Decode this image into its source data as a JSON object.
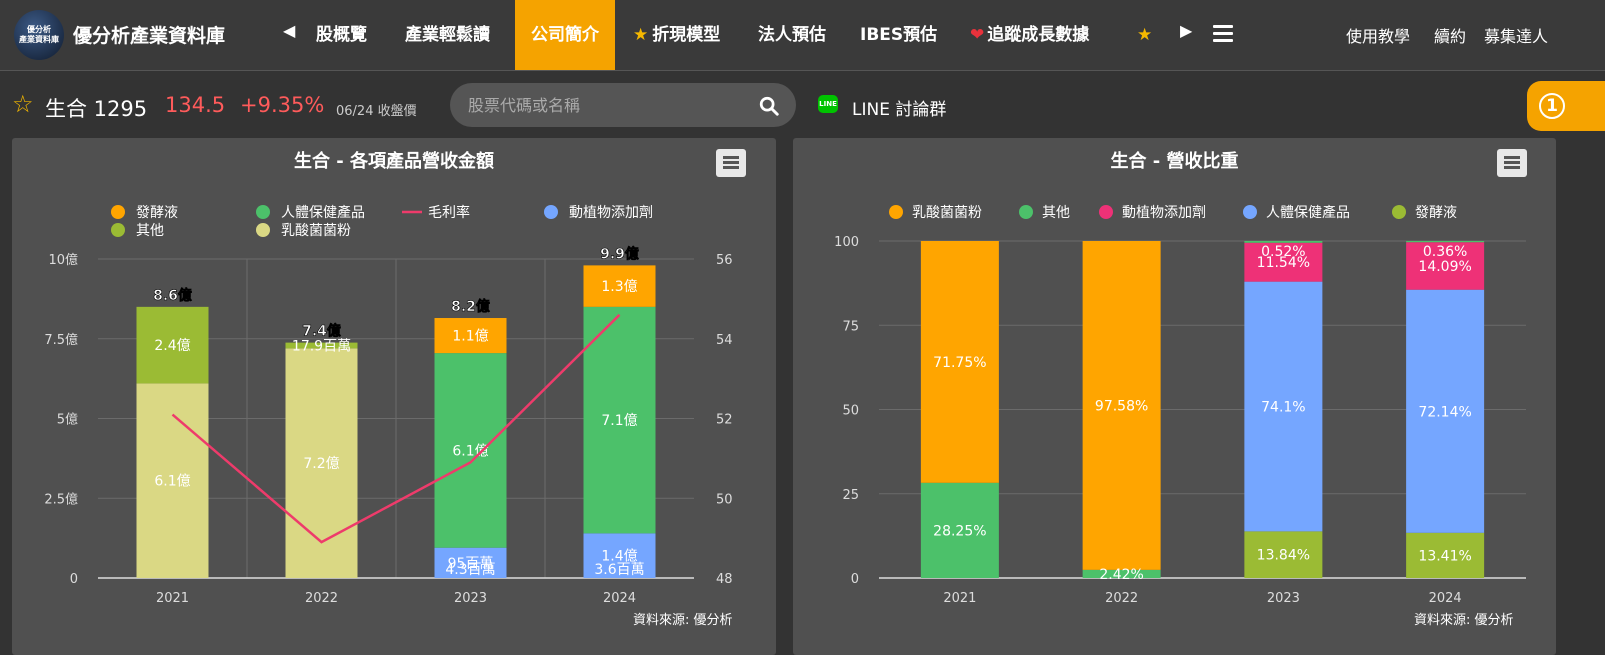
{
  "header": {
    "logo_text": [
      "優分析",
      "產業資料庫"
    ],
    "site_title": "優分析產業資料庫",
    "nav_items": [
      {
        "label": "股概覽",
        "icon": ""
      },
      {
        "label": "產業輕鬆讀",
        "icon": ""
      },
      {
        "label": "公司簡介",
        "icon": "",
        "active": true
      },
      {
        "label": "折現模型",
        "icon": "star-icon"
      },
      {
        "label": "法人預估",
        "icon": ""
      },
      {
        "label": "IBES預估",
        "icon": ""
      },
      {
        "label": "追蹤成長數據",
        "icon": "heart-icon"
      },
      {
        "label": "",
        "icon": "star-icon"
      }
    ],
    "right_links": [
      "使用教學",
      "續約",
      "募集達人"
    ]
  },
  "stock": {
    "name": "生合 1295",
    "price": "134.5",
    "change": "+9.35%",
    "date": "06/24 收盤價"
  },
  "search": {
    "placeholder": "股票代碼或名稱"
  },
  "line_group": {
    "label": "LINE 討論群"
  },
  "notification": {
    "count": "1"
  },
  "colors": {
    "orange": "#ffa500",
    "green": "#4cc16a",
    "lightgreen": "#9bbb34",
    "yellow": "#dad884",
    "blue": "#75a6ff",
    "pink": "#ee3177",
    "line": "#ee3b6b"
  },
  "chart_data": [
    {
      "type": "bar",
      "title": "生合 - 各項產品營收金額",
      "source": "資料來源: 優分析",
      "categories": [
        "2021",
        "2022",
        "2023",
        "2024"
      ],
      "y_ticks": [
        "0",
        "2.5億",
        "5億",
        "7.5億",
        "10億"
      ],
      "y2_ticks": [
        "48",
        "50",
        "52",
        "54",
        "56"
      ],
      "ylim": [
        0,
        10
      ],
      "y2lim": [
        48,
        56
      ],
      "legend": [
        "發酵液",
        "人體保健產品",
        "毛利率",
        "動植物添加劑",
        "其他",
        "乳酸菌菌粉"
      ],
      "series": [
        {
          "name": "乳酸菌菌粉",
          "color": "#dad884",
          "values": [
            6.1,
            7.2,
            0,
            0
          ],
          "labels": [
            "6.1億",
            "7.2億",
            "",
            ""
          ]
        },
        {
          "name": "其他",
          "color": "#9bbb34",
          "values": [
            2.4,
            0.179,
            0,
            0
          ],
          "labels": [
            "2.4億",
            "17.9百萬",
            "",
            ""
          ]
        },
        {
          "name": "動植物添加劑",
          "color": "#75a6ff",
          "values": [
            0,
            0,
            0.95,
            1.4
          ],
          "labels": [
            "",
            "",
            "95百萬",
            "1.4億"
          ]
        },
        {
          "name": "人體保健產品",
          "color": "#4cc16a",
          "values": [
            0,
            0,
            6.1,
            7.1
          ],
          "labels": [
            "",
            "",
            "6.1億",
            "7.1億"
          ]
        },
        {
          "name": "發酵液",
          "color": "#ffa500",
          "values": [
            0,
            0,
            1.1,
            1.3
          ],
          "labels": [
            "",
            "",
            "1.1億",
            "1.3億"
          ]
        }
      ],
      "small_labels": [
        "",
        "",
        "4.3百萬",
        "3.6百萬"
      ],
      "totals": [
        "8.6億",
        "7.4億",
        "8.2億",
        "9.9億"
      ],
      "line_series": {
        "name": "毛利率",
        "values": [
          52.1,
          48.9,
          50.9,
          54.6
        ]
      }
    },
    {
      "type": "bar",
      "title": "生合 - 營收比重",
      "source": "資料來源: 優分析",
      "categories": [
        "2021",
        "2022",
        "2023",
        "2024"
      ],
      "y_ticks": [
        "0",
        "25",
        "50",
        "75",
        "100"
      ],
      "ylim": [
        0,
        100
      ],
      "legend": [
        "乳酸菌菌粉",
        "其他",
        "動植物添加劑",
        "人體保健產品",
        "發酵液"
      ],
      "series": [
        {
          "name": "發酵液",
          "color": "#9bbb34",
          "values": [
            0,
            0,
            13.84,
            13.41
          ],
          "labels": [
            "",
            "",
            "13.84%",
            "13.41%"
          ]
        },
        {
          "name": "人體保健產品",
          "color": "#75a6ff",
          "values": [
            0,
            0,
            74.1,
            72.14
          ],
          "labels": [
            "",
            "",
            "74.1%",
            "72.14%"
          ]
        },
        {
          "name": "動植物添加劑",
          "color": "#ee3177",
          "values": [
            0,
            0,
            11.54,
            14.09
          ],
          "labels": [
            "",
            "",
            "11.54%",
            "14.09%"
          ]
        },
        {
          "name": "其他",
          "color": "#4cc16a",
          "values": [
            28.25,
            2.42,
            0.52,
            0.36
          ],
          "labels": [
            "28.25%",
            "2.42%",
            "0.52%",
            "0.36%"
          ]
        },
        {
          "name": "乳酸菌菌粉",
          "color": "#ffa500",
          "values": [
            71.75,
            97.58,
            0,
            0
          ],
          "labels": [
            "71.75%",
            "97.58%",
            "",
            ""
          ]
        }
      ]
    }
  ]
}
